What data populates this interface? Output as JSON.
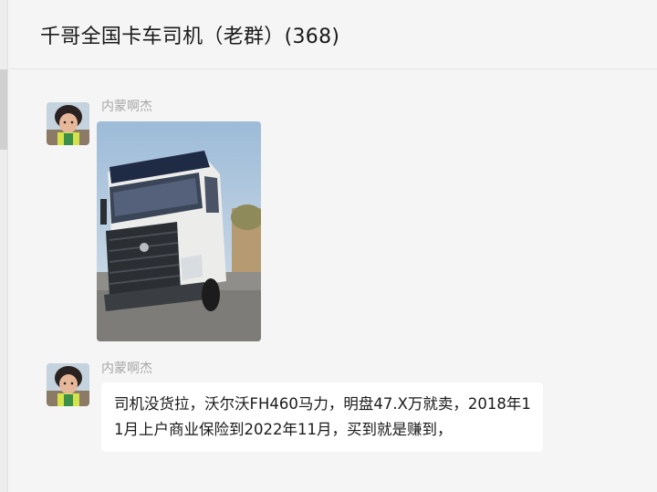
{
  "chat": {
    "title": "千哥全国卡车司机（老群）(368)"
  },
  "messages": [
    {
      "sender": "内蒙啊杰",
      "type": "image",
      "avatar_icon": "child-portrait-avatar",
      "image_icon": "white-volvo-truck-photo"
    },
    {
      "sender": "内蒙啊杰",
      "type": "text",
      "avatar_icon": "child-portrait-avatar",
      "text": "司机没货拉，沃尔沃FH460马力，明盘47.X万就卖，2018年11月上户商业保险到2022年11月，买到就是赚到，"
    }
  ],
  "colors": {
    "background": "#f5f5f5",
    "bubble": "#ffffff",
    "sender_name": "#a8a8a8",
    "text": "#1a1a1a"
  }
}
